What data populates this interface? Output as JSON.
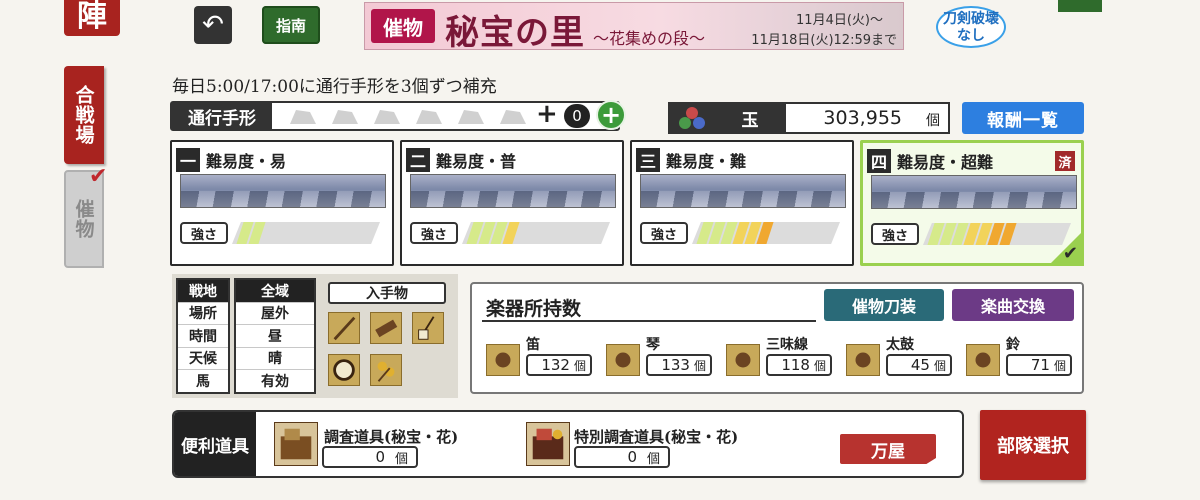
{
  "side": {
    "jin_label": "陣",
    "battle_tab": "合戦場",
    "event_tab": "催物"
  },
  "top": {
    "back_icon": "return-arrow-icon",
    "guide_label": "指南",
    "banner": {
      "tag": "催物",
      "title": "秘宝の里",
      "subtitle": "〜花集めの段〜",
      "date_start": "11月4日(火)〜",
      "date_end": "11月18日(火)12:59まで"
    },
    "break_badge_line1": "刀剣破壊",
    "break_badge_line2": "なし"
  },
  "pass": {
    "refill_text": "毎日5:00/17:00に通行手形を3個ずつ補充",
    "label": "通行手形",
    "plus": "+",
    "count": "0",
    "add": "+"
  },
  "gem": {
    "label": "玉",
    "value": "303,955",
    "unit": "個",
    "reward_button": "報酬一覧"
  },
  "difficulties": [
    {
      "num": "一",
      "title": "難易度・易",
      "strength_label": "強さ",
      "level": 2,
      "done": false
    },
    {
      "num": "二",
      "title": "難易度・普",
      "strength_label": "強さ",
      "level": 4,
      "done": false
    },
    {
      "num": "三",
      "title": "難易度・難",
      "strength_label": "強さ",
      "level": 6,
      "done": false
    },
    {
      "num": "四",
      "title": "難易度・超難",
      "strength_label": "強さ",
      "level": 7,
      "done": true,
      "done_label": "済"
    }
  ],
  "conditions": {
    "keys": [
      "戦地",
      "場所",
      "時間",
      "天候",
      "馬"
    ],
    "values": [
      "全域",
      "屋外",
      "昼",
      "晴",
      "有効"
    ],
    "loot_label": "入手物",
    "loot_items": [
      "flute-item-icon",
      "koto-item-icon",
      "shamisen-item-icon",
      "drum-item-icon",
      "bell-item-icon"
    ]
  },
  "instruments": {
    "title": "楽器所持数",
    "weapon_button": "催物刀装",
    "exchange_button": "楽曲交換",
    "items": [
      {
        "name": "笛",
        "count": "132",
        "unit": "個",
        "icon": "flute-icon"
      },
      {
        "name": "琴",
        "count": "133",
        "unit": "個",
        "icon": "koto-icon"
      },
      {
        "name": "三味線",
        "count": "118",
        "unit": "個",
        "icon": "shamisen-icon"
      },
      {
        "name": "太鼓",
        "count": "45",
        "unit": "個",
        "icon": "taiko-drum-icon"
      },
      {
        "name": "鈴",
        "count": "71",
        "unit": "個",
        "icon": "bell-icon"
      }
    ]
  },
  "tools": {
    "label": "便利道具",
    "items": [
      {
        "name": "調査道具(秘宝・花)",
        "count": "0",
        "unit": "個"
      },
      {
        "name": "特別調査道具(秘宝・花)",
        "count": "0",
        "unit": "個"
      }
    ],
    "shop_button": "万屋"
  },
  "unit_select_button": "部隊選択",
  "colors": {
    "accent_red": "#a8231f",
    "strength_light": "#d6ea8a",
    "strength_mid": "#f2d35a",
    "strength_high": "#f0a830",
    "done_green": "#9ad04f"
  }
}
